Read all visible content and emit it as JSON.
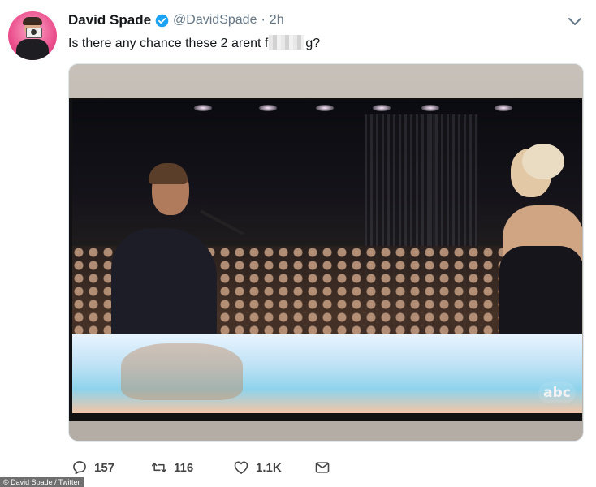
{
  "tweet": {
    "display_name": "David Spade",
    "handle": "@DavidSpade",
    "separator": "·",
    "timestamp": "2h",
    "text_before": "Is there any chance these 2 arent f",
    "text_after": "g?",
    "verified_icon": "verified-badge-icon",
    "menu_icon": "chevron-down-icon"
  },
  "media": {
    "overlay_logo": "abc"
  },
  "actions": {
    "reply_count": "157",
    "retweet_count": "116",
    "like_count": "1.1K"
  },
  "credit": "© David Spade / Twitter",
  "colors": {
    "verified": "#1da1f2",
    "secondary_text": "#657786",
    "primary_text": "#14171a"
  }
}
